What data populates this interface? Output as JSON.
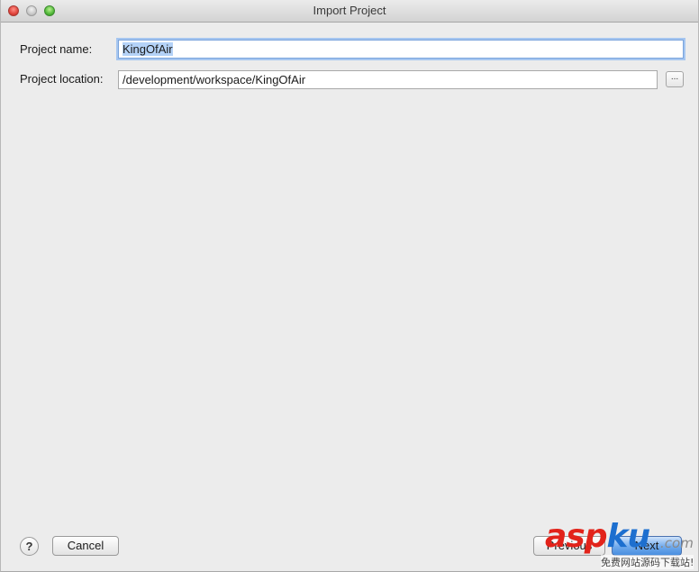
{
  "window": {
    "title": "Import Project"
  },
  "form": {
    "project_name_label": "Project name:",
    "project_name_value": "KingOfAir",
    "project_location_label": "Project location:",
    "project_location_value": "/development/workspace/KingOfAir",
    "browse_label": "..."
  },
  "footer": {
    "help_label": "?",
    "cancel_label": "Cancel",
    "previous_label": "Previous",
    "next_label": "Next"
  },
  "watermark": {
    "brand_a": "asp",
    "brand_b": "ku",
    "suffix": ".com",
    "tagline": "免费网站源码下载站!"
  },
  "colors": {
    "accent": "#4a8fe0",
    "selection": "#b4d2f7",
    "watermark_red": "#e2231a",
    "watermark_blue": "#1d6fcf"
  }
}
